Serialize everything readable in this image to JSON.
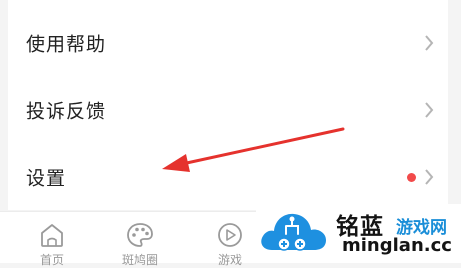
{
  "menu": {
    "items": [
      {
        "label": "使用帮助"
      },
      {
        "label": "投诉反馈"
      },
      {
        "label": "设置",
        "has_notification_dot": true
      }
    ]
  },
  "tabbar": {
    "tabs": [
      {
        "label": "首页",
        "icon": "home-icon"
      },
      {
        "label": "斑鸠圈",
        "icon": "palette-icon"
      },
      {
        "label": "游戏",
        "icon": "play-icon"
      }
    ]
  },
  "annotation": {
    "type": "red-arrow",
    "target": "设置",
    "color": "#e5322d"
  },
  "watermark": {
    "name": "铭蓝",
    "sub": "游戏网",
    "domain": "minglan.cc",
    "colors": {
      "cloud": "#1e90e0",
      "text": "#141414",
      "accent": "#1a8ed8"
    }
  },
  "colors": {
    "dot": "#f24a4a",
    "chevron": "#b5b5b5",
    "label": "#222222"
  }
}
